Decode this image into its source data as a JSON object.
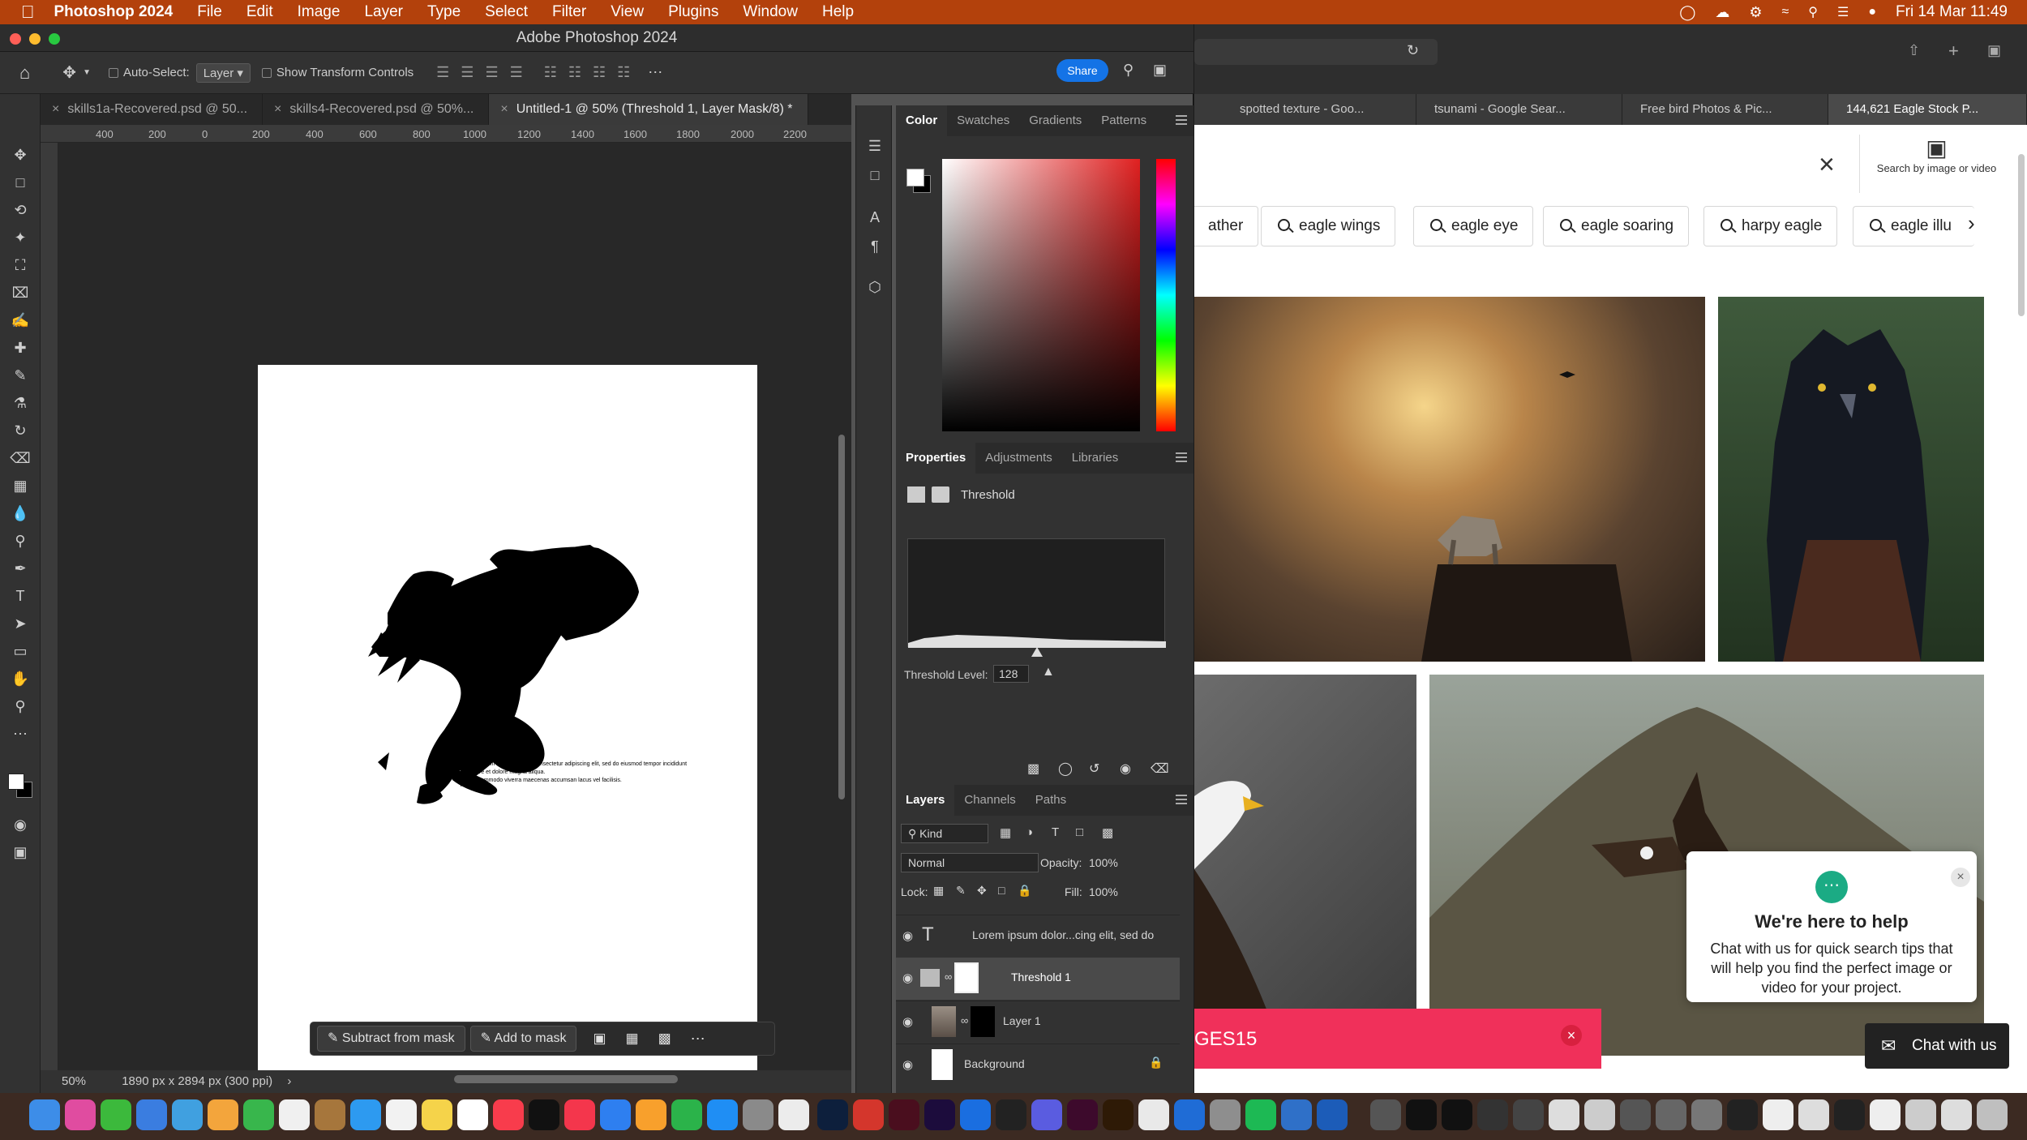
{
  "menubar": {
    "app_name": "Photoshop 2024",
    "items": [
      "File",
      "Edit",
      "Image",
      "Layer",
      "Type",
      "Select",
      "Filter",
      "View",
      "Plugins",
      "Window",
      "Help"
    ],
    "clock": "Fri 14 Mar  11:49"
  },
  "ps": {
    "window_title": "Adobe Photoshop 2024",
    "options": {
      "auto_select_label": "Auto-Select:",
      "auto_select_value": "Layer",
      "show_transform_label": "Show Transform Controls",
      "share_label": "Share"
    },
    "doc_tabs": [
      {
        "label": "skills1a-Recovered.psd @ 50..."
      },
      {
        "label": "skills4-Recovered.psd @ 50%..."
      },
      {
        "label": "Untitled-1 @ 50% (Threshold 1, Layer Mask/8) *"
      }
    ],
    "ruler_ticks": [
      "400",
      "200",
      "0",
      "200",
      "400",
      "600",
      "800",
      "1000",
      "1200",
      "1400",
      "1600",
      "1800",
      "2000",
      "2200"
    ],
    "mask_bar": {
      "subtract": "Subtract from mask",
      "add": "Add to mask"
    },
    "status": {
      "zoom": "50%",
      "doc_info": "1890 px x 2894 px (300 ppi)"
    },
    "color_panel": {
      "tabs": [
        "Color",
        "Swatches",
        "Gradients",
        "Patterns"
      ],
      "hue_color": "#e02020"
    },
    "properties_panel": {
      "tabs": [
        "Properties",
        "Adjustments",
        "Libraries"
      ],
      "adjustment_name": "Threshold",
      "threshold_label": "Threshold Level:",
      "threshold_value": "128"
    },
    "layers_panel": {
      "tabs": [
        "Layers",
        "Channels",
        "Paths"
      ],
      "kind_label": "Kind",
      "blend_mode": "Normal",
      "opacity_label": "Opacity:",
      "opacity_value": "100%",
      "lock_label": "Lock:",
      "fill_label": "Fill:",
      "fill_value": "100%",
      "layers": [
        {
          "name": "Lorem ipsum dolor...cing elit, sed do",
          "type": "text"
        },
        {
          "name": "Threshold 1",
          "type": "adjustment"
        },
        {
          "name": "Layer 1",
          "type": "pixel"
        },
        {
          "name": "Background",
          "type": "background"
        }
      ]
    },
    "eagle_text": [
      "Lorem ipsum dolor sit amet, consectetur adipiscing elit, sed do eiusmod tempor incididunt",
      "ut labore et dolore magna aliqua.",
      "Risus commodo viverra maecenas accumsan lacus vel facilisis."
    ]
  },
  "browser": {
    "tabs": [
      {
        "label": "spotted texture - Goo..."
      },
      {
        "label": "tsunami - Google Sear..."
      },
      {
        "label": "Free bird Photos & Pic..."
      },
      {
        "label": "144,621 Eagle Stock P..."
      }
    ],
    "search_by_image": "Search by image or video",
    "chips": [
      "ather",
      "eagle wings",
      "eagle eye",
      "eagle soaring",
      "harpy eagle",
      "eagle illu"
    ],
    "chat_title": "We're here to help",
    "chat_body": "Chat with us for quick search tips that will help you find the perfect image or video for your project.",
    "chat_button": "Chat with us",
    "promo_code": "GES15"
  }
}
